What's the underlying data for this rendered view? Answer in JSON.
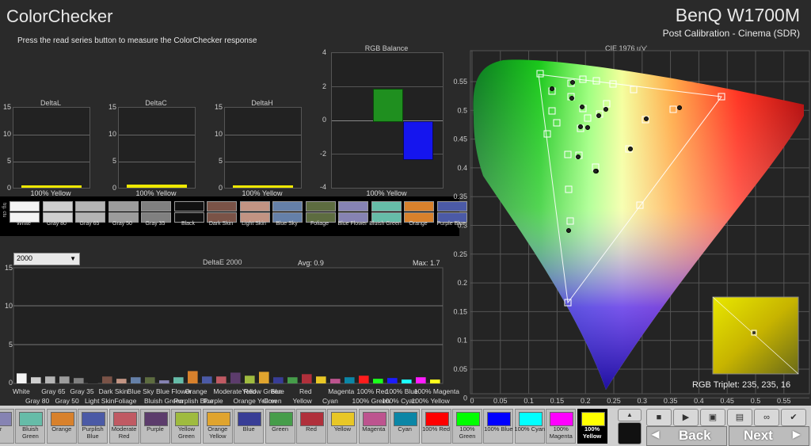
{
  "header": {
    "title": "ColorChecker",
    "subtitle": "Press the read series button to measure the ColorChecker response",
    "device": "BenQ W1700M",
    "calibration": "Post Calibration - Cinema (SDR)"
  },
  "small_charts": [
    {
      "title": "DeltaL",
      "ticks": [
        "15",
        "10",
        "5",
        "0"
      ],
      "footer": "100% Yellow",
      "value": 0.5
    },
    {
      "title": "DeltaC",
      "ticks": [
        "15",
        "10",
        "5",
        "0"
      ],
      "footer": "100% Yellow",
      "value": 0.6
    },
    {
      "title": "DeltaH",
      "ticks": [
        "15",
        "10",
        "5",
        "0"
      ],
      "footer": "100% Yellow",
      "value": 0.4
    }
  ],
  "rgb_balance": {
    "title": "RGB Balance",
    "ticks": [
      "4",
      "2",
      "0",
      "-2",
      "-4"
    ],
    "footer": "100% Yellow",
    "red": 0.0,
    "green": 1.9,
    "blue": -2.2,
    "colors": {
      "green": "#1f8f1f",
      "blue": "#1515ee"
    }
  },
  "swatch_strip": {
    "side_label": "trg. ctu",
    "items": [
      {
        "label": "White",
        "color": "#f4f4f4"
      },
      {
        "label": "Gray 80",
        "color": "#cfcfcf"
      },
      {
        "label": "Gray 65",
        "color": "#b4b4b4"
      },
      {
        "label": "Gray 50",
        "color": "#9c9c9c"
      },
      {
        "label": "Gray 35",
        "color": "#808080"
      },
      {
        "label": "Black",
        "color": "#111111"
      },
      {
        "label": "Dark Skin",
        "color": "#7a5347"
      },
      {
        "label": "Light Skin",
        "color": "#c29483"
      },
      {
        "label": "Blue Sky",
        "color": "#6580a8"
      },
      {
        "label": "Foliage",
        "color": "#5d6c40"
      },
      {
        "label": "Blue Flower",
        "color": "#8683b3"
      },
      {
        "label": "Bluish Green",
        "color": "#66bca8"
      },
      {
        "label": "Orange",
        "color": "#d8812c"
      },
      {
        "label": "Purple Blue",
        "color": "#4b5aa6"
      }
    ]
  },
  "deltae_chart": {
    "dropdown": "2000",
    "title": "DeltaE 2000",
    "avg": "Avg: 0.9",
    "max": "Max: 1.7",
    "ticks": [
      "15",
      "10",
      "5",
      "0"
    ],
    "labels_row1": [
      "White",
      "Gray 65",
      "Gray 35",
      "Dark Skin",
      "Blue Sky",
      "Blue Flower",
      "Orange",
      "Moderate Red",
      "Yellow Green",
      "Blue",
      "Red",
      "Magenta",
      "100% Red",
      "100% Blue",
      "100% Magenta"
    ],
    "labels_row2": [
      "Gray 80",
      "Gray 50",
      "Light Skin",
      "Foliage",
      "Bluish Green",
      "Purplish Blue",
      "Purple",
      "Orange Yellow",
      "Green",
      "Yellow",
      "Cyan",
      "100% Green",
      "100% Cyan",
      "100% Yellow"
    ]
  },
  "chart_data": {
    "type": "bar",
    "title": "DeltaE 2000",
    "ylim": [
      0,
      15
    ],
    "categories": [
      "White",
      "Gray 80",
      "Gray 65",
      "Gray 50",
      "Gray 35",
      "Black",
      "Dark Skin",
      "Light Skin",
      "Blue Sky",
      "Foliage",
      "Blue Flower",
      "Bluish Green",
      "Orange",
      "Purplish Blue",
      "Moderate Red",
      "Purple",
      "Yellow Green",
      "Orange Yellow",
      "Blue",
      "Green",
      "Red",
      "Yellow",
      "Magenta",
      "Cyan",
      "100% Red",
      "100% Green",
      "100% Blue",
      "100% Cyan",
      "100% Magenta",
      "100% Yellow"
    ],
    "values": [
      1.3,
      0.8,
      0.9,
      0.9,
      0.7,
      0.9,
      0.9,
      0.6,
      0.8,
      0.8,
      0.4,
      0.8,
      1.6,
      0.9,
      0.9,
      1.4,
      1.0,
      1.5,
      0.8,
      0.8,
      1.2,
      0.9,
      0.6,
      0.8,
      1.0,
      0.6,
      0.7,
      0.5,
      0.8,
      0.5
    ],
    "colors": [
      "#f4f4f4",
      "#cfcfcf",
      "#b4b4b4",
      "#9c9c9c",
      "#808080",
      "#222222",
      "#7a5347",
      "#c29483",
      "#6580a8",
      "#5d6c40",
      "#8683b3",
      "#66bca8",
      "#d8812c",
      "#4b5aa6",
      "#c05a63",
      "#5c3c6c",
      "#9fbb3f",
      "#e0a42e",
      "#383d96",
      "#469d4a",
      "#b0303b",
      "#e8c726",
      "#bd548f",
      "#0b86a6",
      "#ff1c1c",
      "#1cff1c",
      "#1c1cff",
      "#1cffff",
      "#ff1cff",
      "#ffff1c"
    ]
  },
  "cie": {
    "title": "CIE 1976 u'v'",
    "x_ticks": [
      "0",
      "0.05",
      "0.1",
      "0.15",
      "0.2",
      "0.25",
      "0.3",
      "0.35",
      "0.4",
      "0.45",
      "0.5",
      "0.55"
    ],
    "y_ticks": [
      "0.55",
      "0.5",
      "0.45",
      "0.4",
      "0.35",
      "0.3",
      "0.25",
      "0.2",
      "0.15",
      "0.1",
      "0.05",
      "0"
    ],
    "triplet": "RGB Triplet: 235, 235, 16"
  },
  "patch_bar": {
    "items": [
      {
        "label": "er",
        "color": "#8683b3"
      },
      {
        "label": "Bluish Green",
        "color": "#66bca8"
      },
      {
        "label": "Orange",
        "color": "#d8812c"
      },
      {
        "label": "Purplish Blue",
        "color": "#4b5aa6"
      },
      {
        "label": "Moderate Red",
        "color": "#c05a63"
      },
      {
        "label": "Purple",
        "color": "#5c3c6c"
      },
      {
        "label": "Yellow Green",
        "color": "#9fbb3f"
      },
      {
        "label": "Orange Yellow",
        "color": "#e0a42e"
      },
      {
        "label": "Blue",
        "color": "#383d96"
      },
      {
        "label": "Green",
        "color": "#469d4a"
      },
      {
        "label": "Red",
        "color": "#b0303b"
      },
      {
        "label": "Yellow",
        "color": "#e8c726"
      },
      {
        "label": "Magenta",
        "color": "#bd548f"
      },
      {
        "label": "Cyan",
        "color": "#0b86a6"
      },
      {
        "label": "100% Red",
        "color": "#ff0000"
      },
      {
        "label": "100% Green",
        "color": "#00ff00"
      },
      {
        "label": "100% Blue",
        "color": "#0000ff"
      },
      {
        "label": "100% Cyan",
        "color": "#00ffff"
      },
      {
        "label": "100% Magenta",
        "color": "#ff00ff"
      },
      {
        "label": "100% Yellow",
        "color": "#ffff00",
        "selected": true
      }
    ]
  },
  "nav": {
    "back": "Back",
    "next": "Next"
  }
}
